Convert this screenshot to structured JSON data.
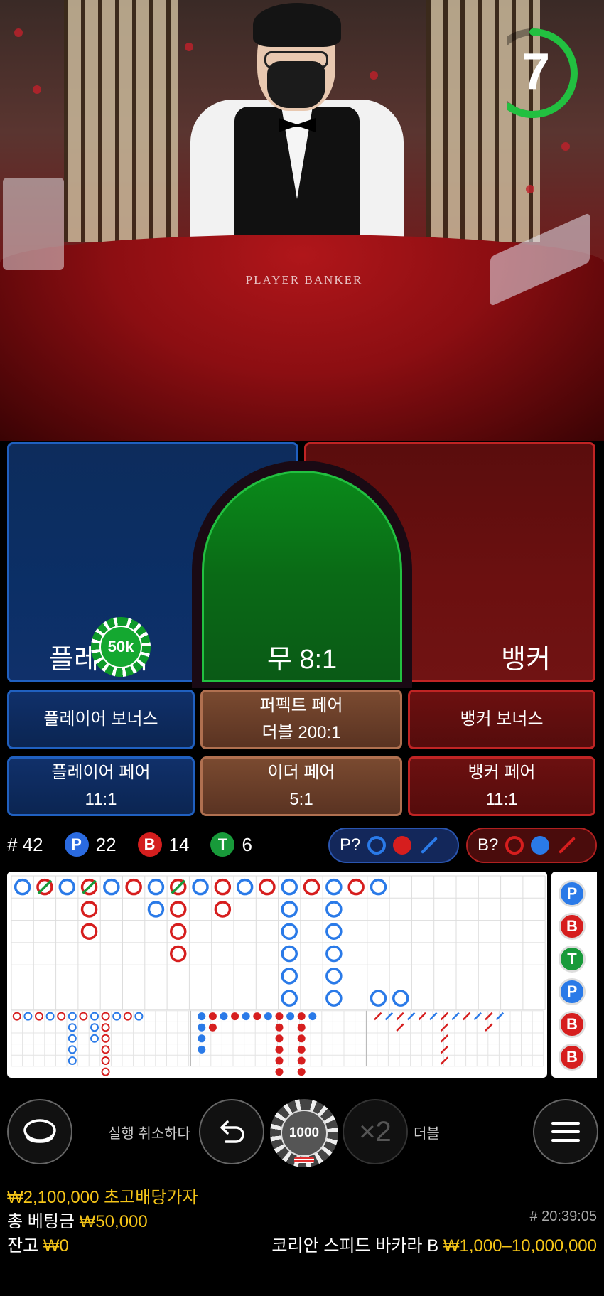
{
  "timer": {
    "seconds": "7",
    "progress": 0.6,
    "color": "#22c040"
  },
  "table_felt_text": "PLAYER  BANKER",
  "bets": {
    "player": {
      "label": "플레이어",
      "chip": "50k"
    },
    "tie": {
      "label": "무 8:1"
    },
    "banker": {
      "label": "뱅커"
    }
  },
  "side_bets": {
    "player_bonus": "플레이어 보너스",
    "perfect_pair": {
      "name": "퍼펙트 페어",
      "odds": "더블 200:1"
    },
    "banker_bonus": "뱅커 보너스",
    "player_pair": {
      "name": "플레이어 페어",
      "odds": "11:1"
    },
    "either_pair": {
      "name": "이더 페어",
      "odds": "5:1"
    },
    "banker_pair": {
      "name": "뱅커 페어",
      "odds": "11:1"
    }
  },
  "stats": {
    "round": "# 42",
    "player": {
      "badge": "P",
      "count": "22"
    },
    "banker": {
      "badge": "B",
      "count": "14"
    },
    "tie": {
      "badge": "T",
      "count": "6"
    }
  },
  "predict": {
    "player": "P?",
    "banker": "B?"
  },
  "bead_road": [
    "P",
    "B",
    "T",
    "P",
    "B",
    "B"
  ],
  "colors": {
    "player": "#2a7ae8",
    "banker": "#d61e1e",
    "tie": "#189a3a",
    "gold": "#f5c518"
  },
  "controls": {
    "undo_label": "실행 취소하다",
    "chip_value": "1000",
    "double_symbol": "×2",
    "double_label": "더블"
  },
  "footer": {
    "max_payout_amount": "₩2,100,000",
    "max_payout_label": "초고배당가자",
    "total_bet_label": "총 베팅금",
    "total_bet_amount": "₩50,000",
    "balance_label": "잔고",
    "balance_amount": "₩0",
    "game_id": "# 20:39:05",
    "table_name": "코리안 스피드 바카라 B",
    "limits": "₩1,000–10,000,000"
  }
}
